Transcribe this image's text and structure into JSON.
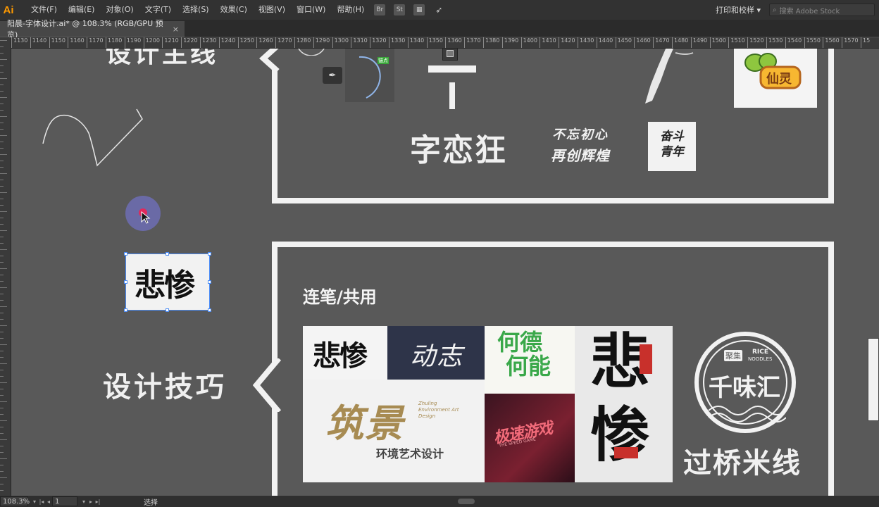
{
  "app": {
    "logo": "Ai",
    "menus": [
      "文件(F)",
      "编辑(E)",
      "对象(O)",
      "文字(T)",
      "选择(S)",
      "效果(C)",
      "视图(V)",
      "窗口(W)",
      "帮助(H)"
    ],
    "workspace": "打印和校样",
    "search_placeholder": "搜索 Adobe Stock"
  },
  "tab": {
    "title": "阳晨-字体设计.ai* @ 108.3% (RGB/GPU 预览)",
    "close": "×"
  },
  "ruler": {
    "ticks": [
      "1130",
      "1140",
      "1150",
      "1160",
      "1170",
      "1180",
      "1190",
      "1200",
      "1210",
      "1220",
      "1230",
      "1240",
      "1250",
      "1260",
      "1270",
      "1280",
      "1290",
      "1300",
      "1310",
      "1320",
      "1330",
      "1340",
      "1350",
      "1360",
      "1370",
      "1380",
      "1390",
      "1400",
      "1410",
      "1420",
      "1430",
      "1440",
      "1450",
      "1460",
      "1470",
      "1480",
      "1490",
      "1500",
      "1510",
      "1520",
      "1530",
      "1540",
      "1550",
      "1560",
      "1570",
      "15"
    ]
  },
  "canvas": {
    "top_heading": "设计主线",
    "design_skills": "设计技巧",
    "section_title": "连笔/共用",
    "selected_logo": "悲惨",
    "top_samples": {
      "sample_a": "字恋狂",
      "sample_b_line1": "不忘初心",
      "sample_b_line2": "再创辉煌",
      "sample_c": "奋斗青年",
      "curve_label": "锚点"
    },
    "grid": {
      "cell1": "悲惨",
      "cell2": "动志",
      "cell3_line1": "何德",
      "cell3_line2": "何能",
      "cell4_top": "悲",
      "cell4_bottom": "惨",
      "cell5_main": "筑景",
      "cell5_sub": "环境艺术设计",
      "cell5_en": "Zhuling Environment Art Design",
      "cell6": "极速游戏",
      "cell6_en": "THE SPEED GAME"
    },
    "badge": {
      "chars_top": "聚集",
      "en_top": "RICE",
      "en_bottom": "NOODLES",
      "main": "千味汇",
      "bottom": "过桥米线"
    }
  },
  "status": {
    "zoom": "108.3%",
    "artboard": "1",
    "tool": "选择"
  },
  "colors": {
    "accent": "#ff9a00",
    "menubar": "#323232",
    "canvas": "#595959",
    "frame": "#f2f2f2",
    "red": "#c8302b",
    "green": "#34a64a",
    "gold": "#a78b52"
  }
}
